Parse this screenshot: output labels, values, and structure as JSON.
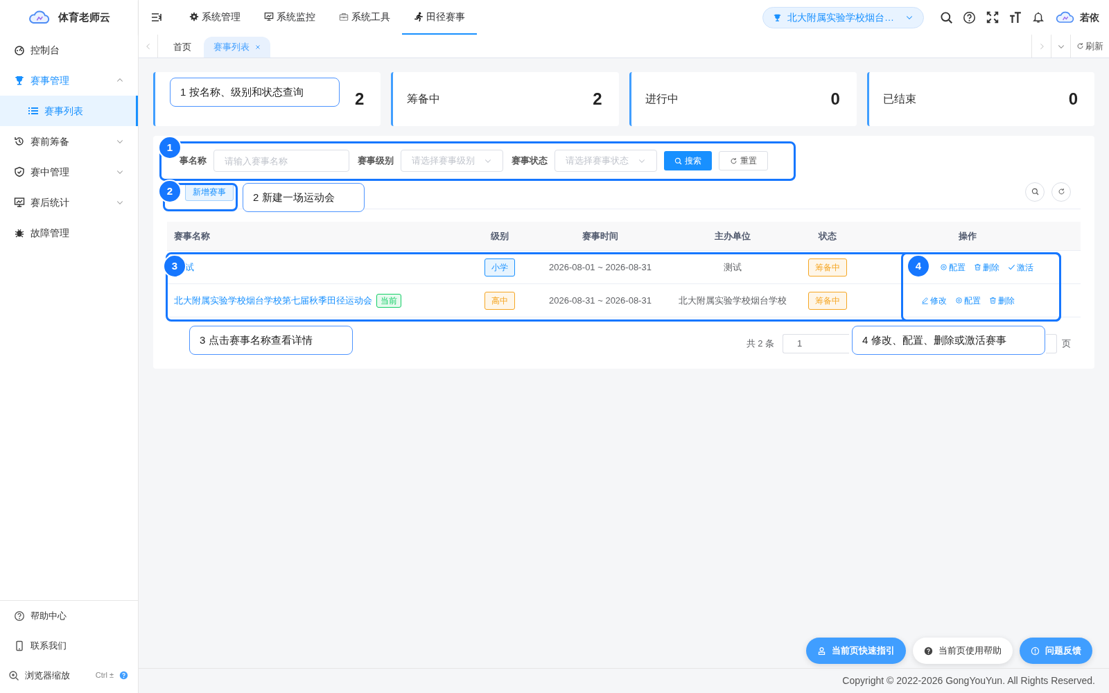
{
  "app": {
    "logo_text": "体育老师云"
  },
  "sidebar": {
    "items": [
      {
        "label": "控制台",
        "selected": false
      },
      {
        "label": "赛事管理",
        "selected": false,
        "expanded": true,
        "children": [
          {
            "label": "赛事列表",
            "selected": true
          }
        ]
      },
      {
        "label": "赛前筹备",
        "selected": false,
        "expanded": false
      },
      {
        "label": "赛中管理",
        "selected": false,
        "expanded": false
      },
      {
        "label": "赛后统计",
        "selected": false,
        "expanded": false
      },
      {
        "label": "故障管理",
        "selected": false
      }
    ],
    "footer": [
      {
        "label": "帮助中心"
      },
      {
        "label": "联系我们"
      },
      {
        "label": "浏览器缩放",
        "hint": "Ctrl ±"
      }
    ]
  },
  "top_nav": {
    "items": [
      {
        "label": "系统管理",
        "selected": false
      },
      {
        "label": "系统监控",
        "selected": false
      },
      {
        "label": "系统工具",
        "selected": false
      },
      {
        "label": "田径赛事",
        "selected": true
      }
    ],
    "school": "北大附属实验学校烟台…",
    "user": "若依"
  },
  "tabs": {
    "items": [
      {
        "label": "首页",
        "selected": false
      },
      {
        "label": "赛事列表",
        "selected": true,
        "closable": true
      }
    ],
    "refresh": "刷新"
  },
  "stats": [
    {
      "value": "2"
    },
    {
      "label": "筹备中",
      "value": "2"
    },
    {
      "label": "进行中",
      "value": "0"
    },
    {
      "label": "已结束",
      "value": "0"
    }
  ],
  "search": {
    "fields": [
      {
        "label": "事名称",
        "kind": "input",
        "placeholder": "请输入赛事名称"
      },
      {
        "label": "赛事级别",
        "kind": "select",
        "placeholder": "请选择赛事级别"
      },
      {
        "label": "赛事状态",
        "kind": "select",
        "placeholder": "请选择赛事状态"
      }
    ],
    "buttons": [
      {
        "label": "搜索",
        "kind": "primary"
      },
      {
        "label": "重置",
        "kind": "default"
      }
    ]
  },
  "toolbar": {
    "add": "新增赛事"
  },
  "table": {
    "columns": [
      "赛事名称",
      "级别",
      "赛事时间",
      "主办单位",
      "状态",
      "操作"
    ],
    "rows": [
      {
        "name": "试",
        "level": {
          "text": "小学",
          "color": "#1890ff"
        },
        "time": "2026-08-01 ~ 2026-08-31",
        "host": "测试",
        "status": {
          "text": "筹备中",
          "color": "#f5a623"
        },
        "actions": [
          {
            "label": "配置",
            "kind": "config"
          },
          {
            "label": "删除",
            "kind": "delete"
          },
          {
            "label": "激活",
            "kind": "activate"
          }
        ]
      },
      {
        "name": "北大附属实验学校烟台学校第七届秋季田径运动会",
        "tag": {
          "text": "当前",
          "color": "#13ce66"
        },
        "level": {
          "text": "高中",
          "color": "#f5a623"
        },
        "time": "2026-08-31 ~ 2026-08-31",
        "host": "北大附属实验学校烟台学校",
        "status": {
          "text": "筹备中",
          "color": "#f5a623"
        },
        "actions": [
          {
            "label": "修改",
            "kind": "edit"
          },
          {
            "label": "配置",
            "kind": "config"
          },
          {
            "label": "删除",
            "kind": "delete"
          }
        ]
      }
    ]
  },
  "pagination": {
    "total": "共 2 条",
    "page": "1",
    "suffix": "页"
  },
  "tour": [
    {
      "number": "1",
      "text": "1 按名称、级别和状态查询"
    },
    {
      "number": "2",
      "text": "2 新建一场运动会"
    },
    {
      "number": "3",
      "text": "3 点击赛事名称查看详情"
    },
    {
      "number": "4",
      "text": "4 修改、配置、删除或激活赛事"
    }
  ],
  "float_buttons": [
    {
      "label": "当前页快速指引",
      "kind": "primary"
    },
    {
      "label": "当前页使用帮助",
      "kind": "default"
    },
    {
      "label": "问题反馈",
      "kind": "primary"
    }
  ],
  "footer": "Copyright © 2022-2026 GongYouYun. All Rights Reserved."
}
